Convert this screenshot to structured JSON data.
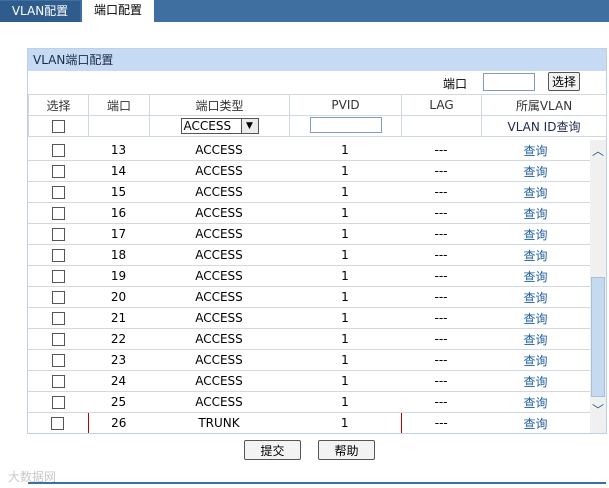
{
  "tabs": [
    {
      "label": "VLAN配置"
    },
    {
      "label": "端口配置"
    }
  ],
  "panel": {
    "title": "VLAN端口配置",
    "port_search_label": "端口",
    "port_search_value": "",
    "select_button": "选择"
  },
  "headers": {
    "select": "选择",
    "port": "端口",
    "port_type": "端口类型",
    "pvid": "PVID",
    "lag": "LAG",
    "vlan": "所属VLAN"
  },
  "filter": {
    "port_type_selected": "ACCESS",
    "pvid_value": "",
    "vlan_id_query": "VLAN ID查询"
  },
  "rows": [
    {
      "port": "13",
      "type": "ACCESS",
      "pvid": "1",
      "lag": "---",
      "vlan": "查询"
    },
    {
      "port": "14",
      "type": "ACCESS",
      "pvid": "1",
      "lag": "---",
      "vlan": "查询"
    },
    {
      "port": "15",
      "type": "ACCESS",
      "pvid": "1",
      "lag": "---",
      "vlan": "查询"
    },
    {
      "port": "16",
      "type": "ACCESS",
      "pvid": "1",
      "lag": "---",
      "vlan": "查询"
    },
    {
      "port": "17",
      "type": "ACCESS",
      "pvid": "1",
      "lag": "---",
      "vlan": "查询"
    },
    {
      "port": "18",
      "type": "ACCESS",
      "pvid": "1",
      "lag": "---",
      "vlan": "查询"
    },
    {
      "port": "19",
      "type": "ACCESS",
      "pvid": "1",
      "lag": "---",
      "vlan": "查询"
    },
    {
      "port": "20",
      "type": "ACCESS",
      "pvid": "1",
      "lag": "---",
      "vlan": "查询"
    },
    {
      "port": "21",
      "type": "ACCESS",
      "pvid": "1",
      "lag": "---",
      "vlan": "查询"
    },
    {
      "port": "22",
      "type": "ACCESS",
      "pvid": "1",
      "lag": "---",
      "vlan": "查询"
    },
    {
      "port": "23",
      "type": "ACCESS",
      "pvid": "1",
      "lag": "---",
      "vlan": "查询"
    },
    {
      "port": "24",
      "type": "ACCESS",
      "pvid": "1",
      "lag": "---",
      "vlan": "查询"
    },
    {
      "port": "25",
      "type": "ACCESS",
      "pvid": "1",
      "lag": "---",
      "vlan": "查询"
    },
    {
      "port": "26",
      "type": "TRUNK",
      "pvid": "1",
      "lag": "---",
      "vlan": "查询"
    }
  ],
  "buttons": {
    "submit": "提交",
    "help": "帮助"
  },
  "watermark": "大数据网",
  "colors": {
    "tab_bar": "#3f6fa0",
    "panel_header": "#c6dbf3",
    "link": "#1f5fa0",
    "highlight": "#c00000"
  }
}
